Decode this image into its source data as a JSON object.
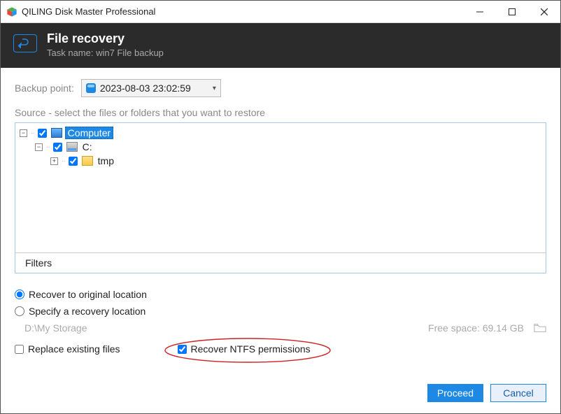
{
  "window": {
    "title": "QILING Disk Master Professional"
  },
  "header": {
    "title": "File recovery",
    "subtitle": "Task name: win7 File backup"
  },
  "backup_point": {
    "label": "Backup point:",
    "selected": "2023-08-03 23:02:59"
  },
  "source": {
    "label": "Source - select the files or folders that you want to restore",
    "tree": {
      "root": {
        "label": "Computer",
        "checked": true,
        "expanded": true,
        "selected": true
      },
      "drive": {
        "label": "C:",
        "checked": true,
        "expanded": true
      },
      "folder": {
        "label": "tmp",
        "checked": true,
        "expanded": false
      }
    },
    "filters_label": "Filters"
  },
  "location": {
    "opt_original": "Recover to original location",
    "opt_specify": "Specify a recovery location",
    "path": "D:\\My Storage",
    "free_space": "Free space: 69.14 GB"
  },
  "options": {
    "replace_label": "Replace existing files",
    "replace_checked": false,
    "ntfs_label": "Recover NTFS permissions",
    "ntfs_checked": true
  },
  "buttons": {
    "proceed": "Proceed",
    "cancel": "Cancel"
  }
}
